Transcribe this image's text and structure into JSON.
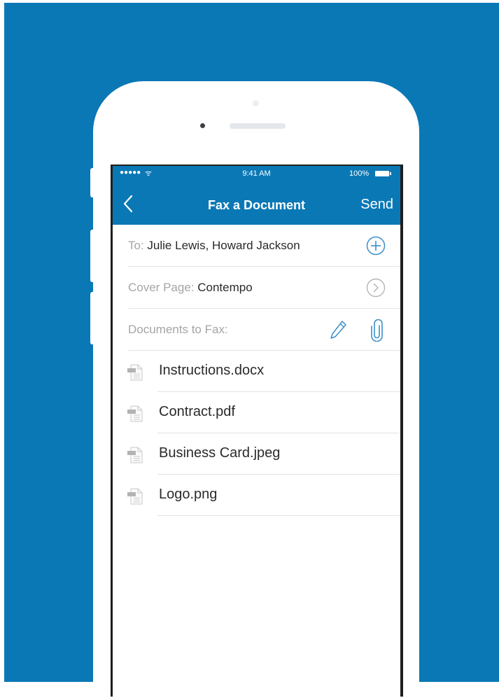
{
  "status_bar": {
    "signal": "●●●●●",
    "wifi": "ᯤ",
    "time": "9:41 AM",
    "battery": "100%"
  },
  "nav": {
    "back_icon": "chevron-left-icon",
    "title": "Fax a Document",
    "send_label": "Send"
  },
  "to_row": {
    "label": "To:",
    "value": "Julie Lewis, Howard Jackson",
    "action_icon": "add-circle-icon"
  },
  "cover_row": {
    "label": "Cover Page:",
    "value": "Contempo",
    "action_icon": "chevron-right-circle-icon"
  },
  "docs_row": {
    "label": "Documents to Fax:",
    "actions": [
      "pencil-icon",
      "paperclip-icon"
    ]
  },
  "documents": [
    {
      "name": "Instructions.docx",
      "icon": "document-icon"
    },
    {
      "name": "Contract.pdf",
      "icon": "document-icon"
    },
    {
      "name": "Business Card.jpeg",
      "icon": "document-icon"
    },
    {
      "name": "Logo.png",
      "icon": "document-icon"
    }
  ],
  "colors": {
    "brand": "#0b78b6",
    "accent_icon": "#3b8fc9",
    "muted_text": "#a5a5a5",
    "text": "#2a2a2a"
  }
}
